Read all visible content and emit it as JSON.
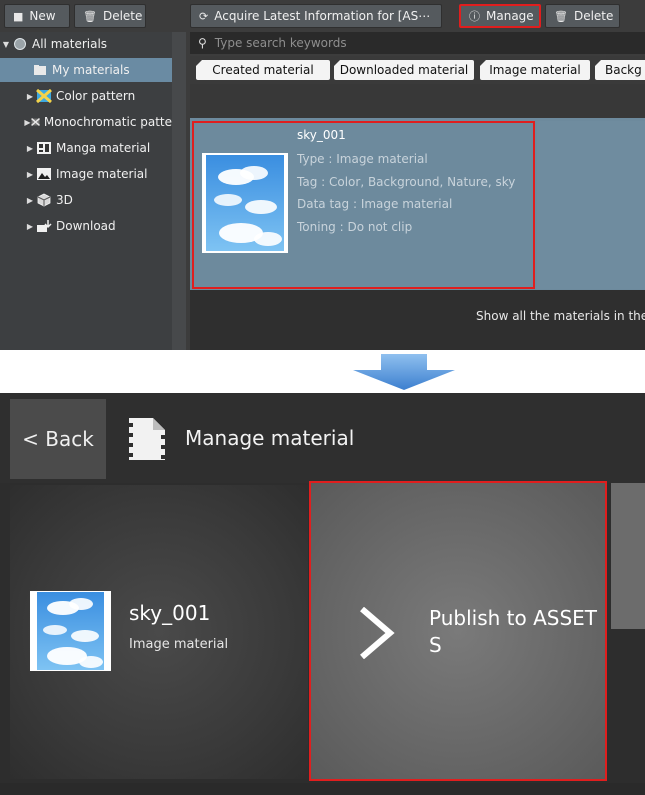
{
  "toolbar": {
    "new_label": "New",
    "delete_label": "Delete",
    "acquire_label": "Acquire Latest Information for [AS⋯",
    "manage_label": "Manage",
    "delete2_label": "Delete"
  },
  "tree": {
    "items": [
      {
        "label": "All materials",
        "icon": "globe-icon"
      },
      {
        "label": "My materials",
        "icon": "folder-icon"
      },
      {
        "label": "Color pattern",
        "icon": "color-pattern-icon"
      },
      {
        "label": "Monochromatic patte",
        "icon": "mono-pattern-icon"
      },
      {
        "label": "Manga material",
        "icon": "manga-icon"
      },
      {
        "label": "Image material",
        "icon": "image-icon"
      },
      {
        "label": "3D",
        "icon": "cube-icon"
      },
      {
        "label": "Download",
        "icon": "download-icon"
      }
    ]
  },
  "search": {
    "placeholder": "Type search keywords"
  },
  "tags": [
    "Created material",
    "Downloaded material",
    "Image material",
    "Backg"
  ],
  "material": {
    "name": "sky_001",
    "type_line": "Type : Image material",
    "tag_line": "Tag : Color, Background, Nature, sky",
    "data_tag_line": "Data tag : Image material",
    "toning_line": "Toning : Do not clip"
  },
  "status": {
    "show_all": "Show all the materials in the"
  },
  "manage_screen": {
    "back_label": "< Back",
    "title": "Manage material",
    "material_name": "sky_001",
    "material_type": "Image material",
    "publish_label": "Publish to ASSETS"
  },
  "colors": {
    "highlight": "#e01e1e",
    "selection": "#6a8ba3",
    "arrow": "#4a8cd6"
  }
}
